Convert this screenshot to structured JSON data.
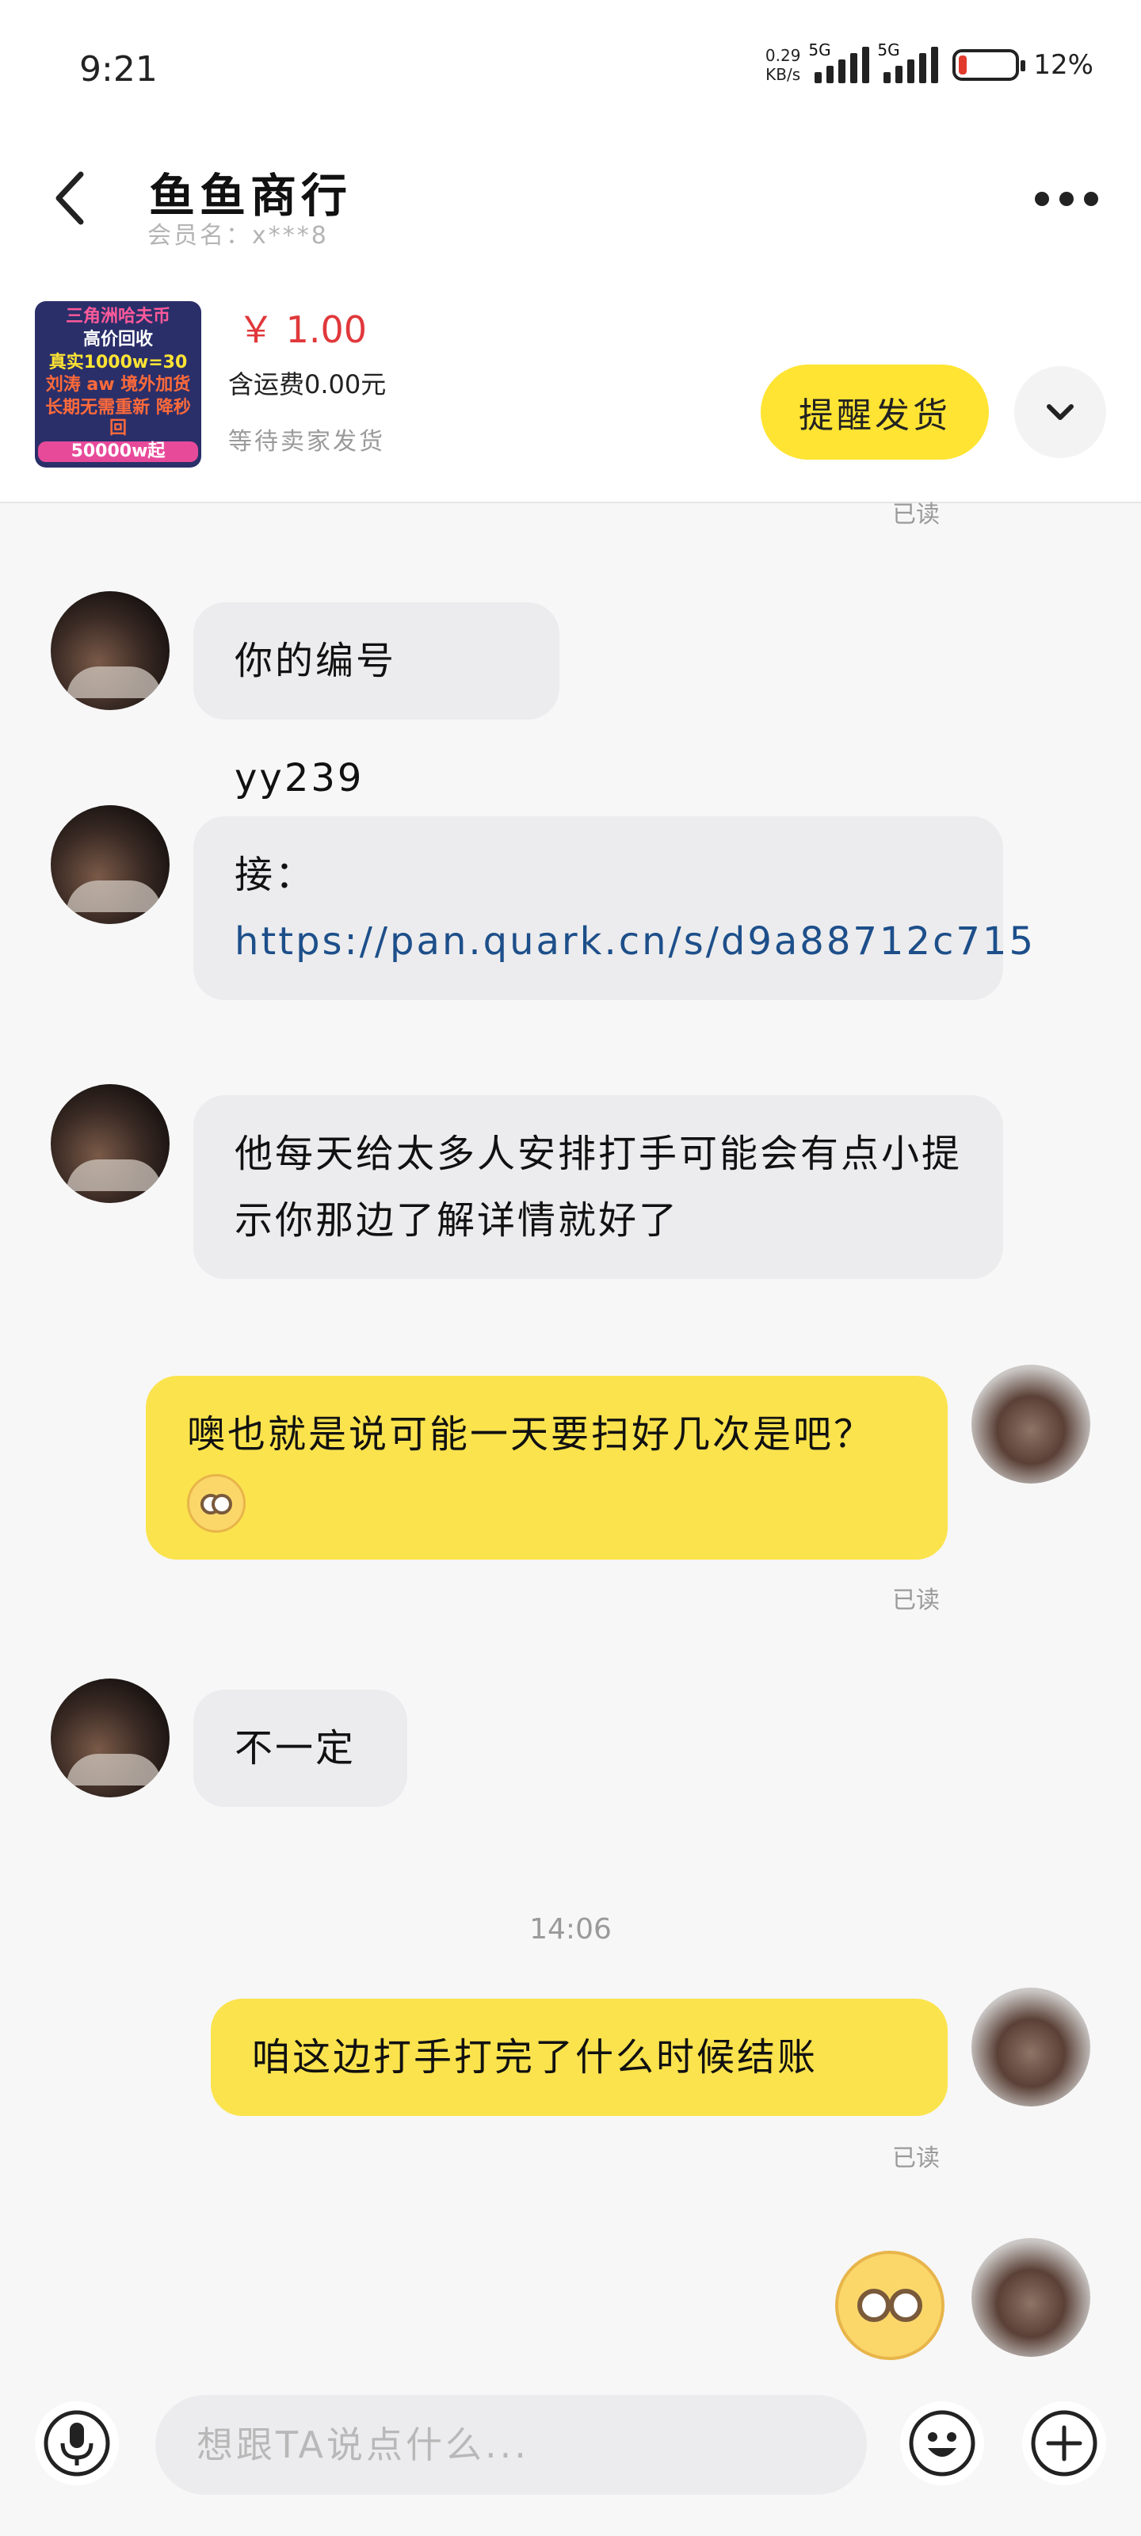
{
  "status_bar": {
    "time": "9:21",
    "net_speed_value": "0.29",
    "net_speed_unit": "KB/s",
    "signal1_label": "5G",
    "signal2_label": "5G",
    "battery_percent": "12%",
    "battery_level": 0.12,
    "battery_color": "#e23b2e"
  },
  "header": {
    "title": "鱼鱼商行",
    "member_label": "会员名：x***8",
    "back_icon": "chevron-left-icon",
    "more_icon": "more-dots-icon"
  },
  "order": {
    "thumb_lines": [
      "三角洲哈夫币",
      "高价回收",
      "真实1000w=30",
      "刘涛 aw 境外加货",
      "长期无需重新 降秒回",
      "50000w起"
    ],
    "price": "￥ 1.00",
    "shipping": "含运费0.00元",
    "status": "等待卖家发货",
    "remind_button": "提醒发货",
    "expand_icon": "chevron-down-icon",
    "accent_color": "#ffe433",
    "price_color": "#e0383b"
  },
  "chat": {
    "partial_read_label": "已读",
    "messages": [
      {
        "side": "in",
        "text": "你的编号yy239"
      },
      {
        "side": "in",
        "prefix": "接：",
        "link": "https://pan.quark.cn/s/d9a88712c715"
      },
      {
        "side": "in",
        "text": "他每天给太多人安排打手可能会有点小提示你那边了解详情就好了"
      },
      {
        "side": "out",
        "text": "噢也就是说可能一天要扫好几次是吧？",
        "emoji": "flushed-face-icon",
        "read": "已读"
      },
      {
        "side": "in",
        "text": "不一定"
      },
      {
        "side": "out",
        "text": "咱这边打手打完了什么时候结账",
        "read": "已读"
      },
      {
        "side": "out",
        "emoji": "flushed-face-icon"
      }
    ],
    "timestamp": "14:06",
    "incoming_bubble_color": "#ececee",
    "outgoing_bubble_color": "#fbe34d"
  },
  "input_bar": {
    "placeholder": "想跟TA说点什么...",
    "voice_icon": "microphone-icon",
    "emoji_icon": "smile-icon",
    "plus_icon": "plus-icon"
  }
}
